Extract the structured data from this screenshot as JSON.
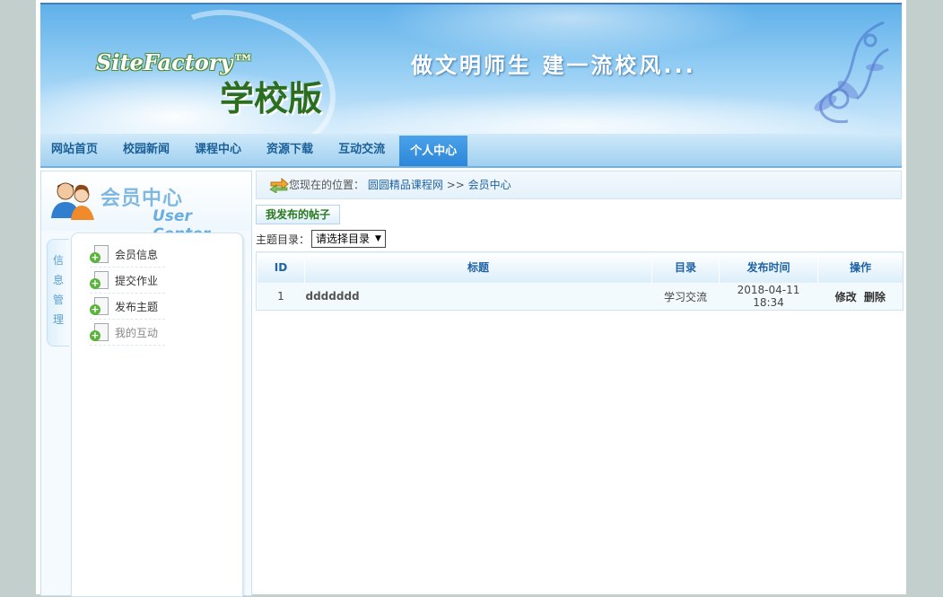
{
  "banner": {
    "brand": "SiteFactory™",
    "brand_sub": "学校版",
    "slogan": "做文明师生 建一流校风..."
  },
  "nav": {
    "items": [
      {
        "label": "网站首页"
      },
      {
        "label": "校园新闻"
      },
      {
        "label": "课程中心"
      },
      {
        "label": "资源下载"
      },
      {
        "label": "互动交流"
      },
      {
        "label": "个人中心"
      }
    ],
    "active_index": 5
  },
  "user_center": {
    "title": "会员中心",
    "title_en": "User Center",
    "side_tab": [
      "信",
      "息",
      "管",
      "理"
    ],
    "menu": [
      {
        "label": "会员信息"
      },
      {
        "label": "提交作业"
      },
      {
        "label": "发布主题"
      },
      {
        "label": "我的互动"
      }
    ]
  },
  "breadcrumb": {
    "prefix": "您现在的位置：",
    "site": "圆圆精品课程网",
    "sep": ">>",
    "current": "会员中心"
  },
  "main": {
    "tab_label": "我发布的帖子",
    "filter_label": "主题目录：",
    "filter_value": "请选择目录"
  },
  "table": {
    "headers": [
      "ID",
      "标题",
      "目录",
      "发布时间",
      "操作"
    ],
    "rows": [
      {
        "id": "1",
        "title": "ddddddd",
        "category": "学习交流",
        "time": "2018-04-11 18:34",
        "edit": "修改",
        "delete": "删除"
      }
    ]
  },
  "colors": {
    "accent": "#2d86d8",
    "nav_text": "#1a5f98",
    "header_text": "#1f62a5",
    "tab_text": "#2a7a1f",
    "background": "#c3cfcd"
  }
}
